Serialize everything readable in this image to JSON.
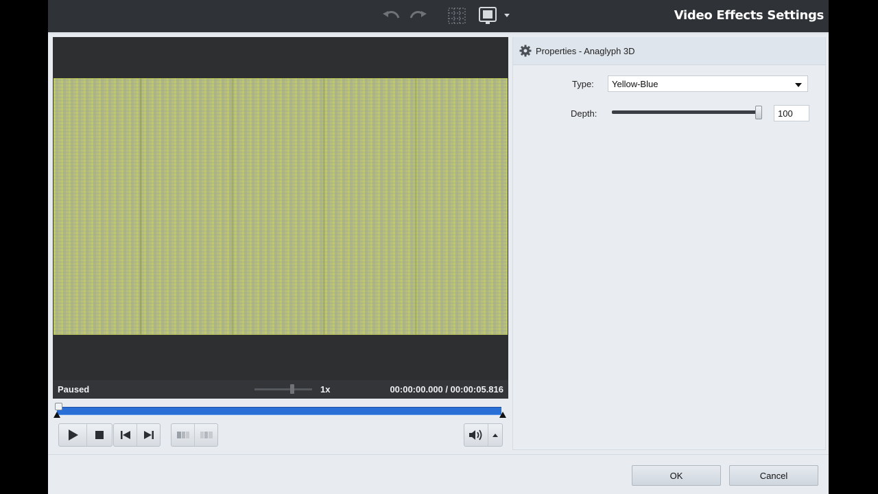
{
  "window": {
    "title": "Video Effects Settings"
  },
  "toolbar": {
    "undo_icon": "undo-icon",
    "redo_icon": "redo-icon",
    "grid_icon": "grid-icon",
    "display_icon": "monitor-icon"
  },
  "player": {
    "status": "Paused",
    "speed": "1x",
    "speed_level": 0.65,
    "current_time": "00:00:00.000",
    "separator": "/",
    "total_time": "00:00:05.816",
    "seek_position": 0.0
  },
  "properties": {
    "header": "Properties - Anaglyph 3D",
    "type_label": "Type:",
    "type_value": "Yellow-Blue",
    "depth_label": "Depth:",
    "depth_value": "100",
    "depth_level": 1.0
  },
  "footer": {
    "ok_label": "OK",
    "cancel_label": "Cancel"
  },
  "colors": {
    "toolbar_bg": "#2f3338",
    "seek_bar": "#2a6fd6",
    "dialog_bg": "#e8ecf1"
  }
}
